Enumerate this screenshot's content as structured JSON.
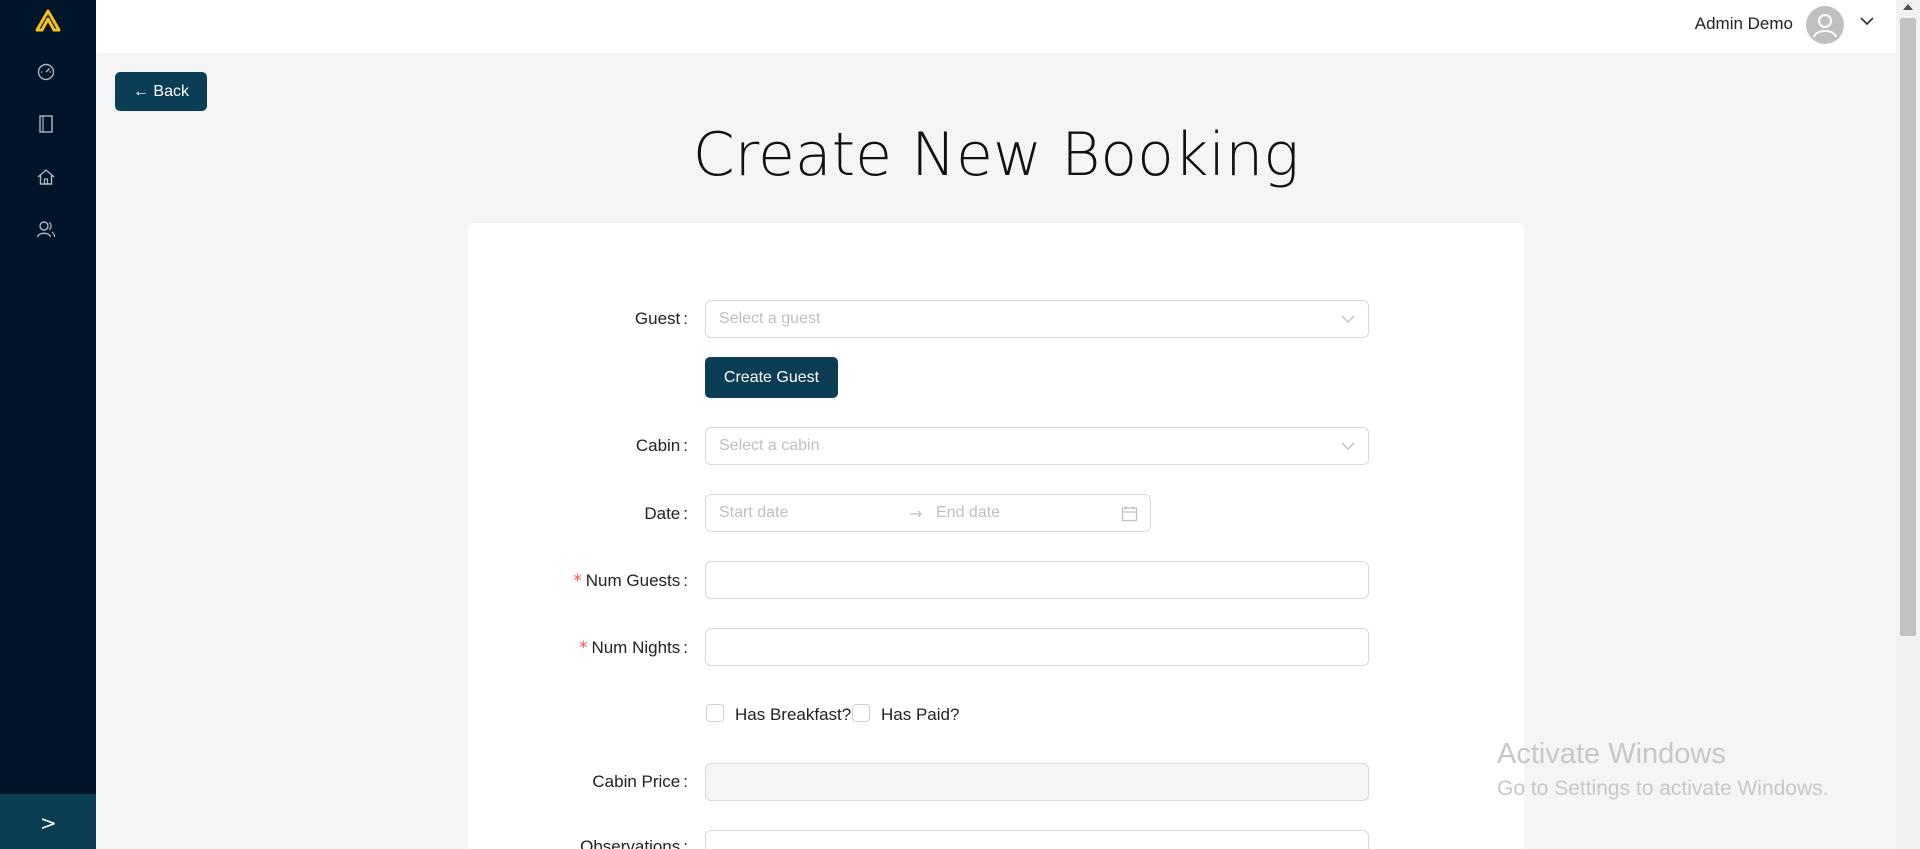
{
  "header": {
    "user_name": "Admin Demo"
  },
  "nav": {
    "back_label": "← Back"
  },
  "page": {
    "title": "Create New Booking"
  },
  "form": {
    "guest": {
      "label": "Guest",
      "placeholder": "Select a guest"
    },
    "create_guest_label": "Create Guest",
    "cabin": {
      "label": "Cabin",
      "placeholder": "Select a cabin"
    },
    "date": {
      "label": "Date",
      "start_placeholder": "Start date",
      "end_placeholder": "End date",
      "separator": "→"
    },
    "num_guests": {
      "label": "Num Guests",
      "value": ""
    },
    "num_nights": {
      "label": "Num Nights",
      "value": ""
    },
    "has_breakfast_label": "Has Breakfast?",
    "has_paid_label": "Has Paid?",
    "cabin_price": {
      "label": "Cabin Price",
      "value": ""
    },
    "observations": {
      "label": "Observations"
    }
  },
  "sidebar": {
    "expand_glyph": ">"
  },
  "watermark": {
    "line1": "Activate Windows",
    "line2": "Go to Settings to activate Windows."
  },
  "colors": {
    "sidebar_bg": "#001529",
    "primary_button": "#0b3d55",
    "logo_accent": "#f5c518",
    "required_marker": "#ff4d4f"
  }
}
